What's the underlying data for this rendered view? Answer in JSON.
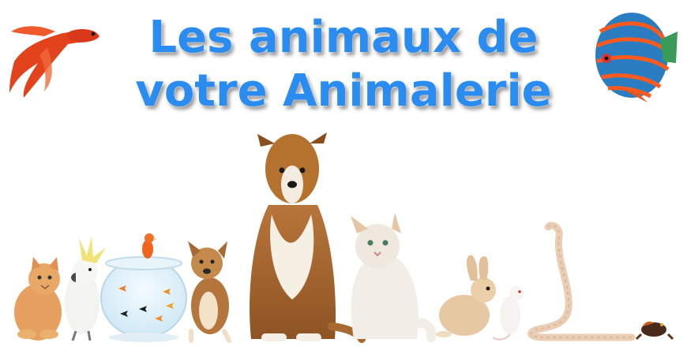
{
  "title": {
    "line1": "Les animaux de",
    "line2": "votre Animalerie"
  },
  "colors": {
    "title": "#2a8cf0",
    "background": "#ffffff"
  },
  "illustrations": [
    "betta-fish",
    "discus-fish",
    "kitten",
    "cockatoo",
    "fishbowl-goldfish",
    "canary",
    "chihuahua",
    "shetland-sheepdog",
    "white-cat",
    "rabbit",
    "rat",
    "snake",
    "frog"
  ]
}
